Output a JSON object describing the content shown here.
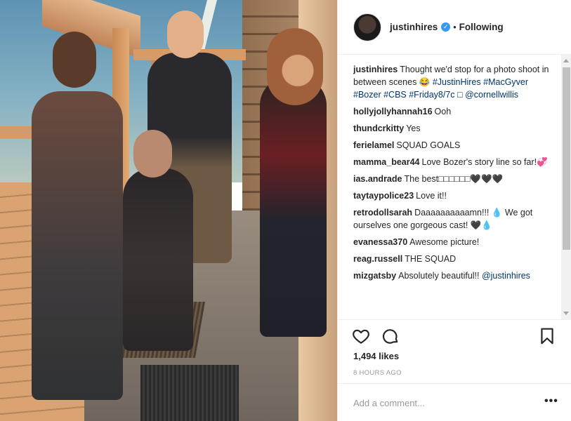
{
  "post": {
    "author": "justinhires",
    "following_label": "Following",
    "separator": "•"
  },
  "comments": [
    {
      "user": "justinhires",
      "text": "Thought we'd stop for a photo shoot in between scenes 😂 ",
      "tags": [
        "#JustinHires",
        "#MacGyver",
        "#Bozer",
        "#CBS",
        "#Friday8/7c",
        "□",
        "@cornellwillis"
      ]
    },
    {
      "user": "hollyjollyhannah16",
      "text": "Ooh",
      "tags": []
    },
    {
      "user": "thundcrkitty",
      "text": "Yes",
      "tags": []
    },
    {
      "user": "ferielamel",
      "text": "SQUAD GOALS",
      "tags": []
    },
    {
      "user": "mamma_bear44",
      "text": "Love Bozer's story line so far!💞",
      "tags": []
    },
    {
      "user": "ias.andrade",
      "text": "The best□□□□□□🖤🖤🖤",
      "tags": []
    },
    {
      "user": "taytaypolice23",
      "text": "Love it!!",
      "tags": []
    },
    {
      "user": "retrodollsarah",
      "text": "Daaaaaaaaaamn!!! 💧 We got ourselves one gorgeous cast! 🖤💧",
      "tags": []
    },
    {
      "user": "evanessa370",
      "text": "Awesome picture!",
      "tags": []
    },
    {
      "user": "reag.russell",
      "text": "THE SQUAD",
      "tags": []
    },
    {
      "user": "mizgatsby",
      "text": "Absolutely beautiful!! ",
      "tags": [
        "@justinhires"
      ]
    }
  ],
  "stats": {
    "likes": "1,494 likes",
    "time": "8 HOURS AGO"
  },
  "composer": {
    "placeholder": "Add a comment...",
    "more_label": "•••"
  },
  "icons": {
    "like": "heart-icon",
    "comment": "comment-bubble-icon",
    "save": "bookmark-icon",
    "verified": "verified-badge-icon"
  },
  "colors": {
    "link": "#003569",
    "verified": "#3897f0",
    "muted": "#999999"
  }
}
